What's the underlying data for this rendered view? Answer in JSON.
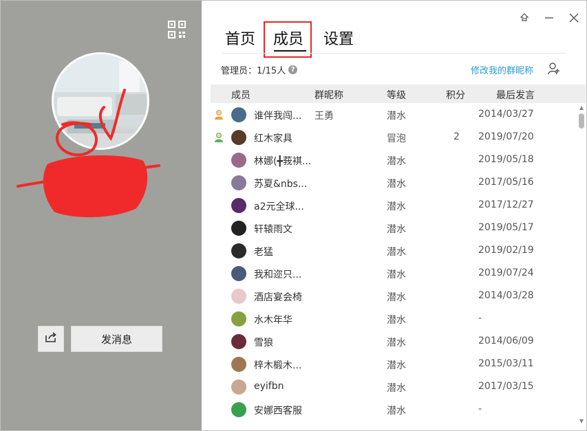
{
  "tabs": [
    {
      "label": "首页"
    },
    {
      "label": "成员"
    },
    {
      "label": "设置"
    }
  ],
  "window_controls": {
    "pin_icon": "pin-icon",
    "minimize_icon": "minimize-icon",
    "close_icon": "close-icon"
  },
  "left": {
    "send_message_label": "发消息",
    "share_icon": "share-icon",
    "qr_icon": "qr-code-icon"
  },
  "admin": {
    "label": "管理员：1/15人",
    "help": "?"
  },
  "edit_nickname_link": "修改我的群昵称",
  "columns": {
    "member": "成员",
    "nickname": "群昵称",
    "level": "等级",
    "points": "积分",
    "last_post": "最后发言"
  },
  "members": [
    {
      "name": "谁伴我闯...",
      "nickname": "王勇",
      "level": "潜水",
      "points": "",
      "last_post": "2014/03/27",
      "role": "owner",
      "avatar_color": "#4a6b8a"
    },
    {
      "name": "红木家具",
      "nickname": "",
      "level": "冒泡",
      "points": "2",
      "last_post": "2019/07/20",
      "role": "admin",
      "avatar_color": "#5a3a2a"
    },
    {
      "name": "林娜(╋莪褀...",
      "nickname": "",
      "level": "潜水",
      "points": "",
      "last_post": "2019/05/18",
      "role": "",
      "avatar_color": "#9a6a8a"
    },
    {
      "name": "苏夏&nbs...",
      "nickname": "",
      "level": "潜水",
      "points": "",
      "last_post": "2017/05/16",
      "role": "",
      "avatar_color": "#8a7a9a"
    },
    {
      "name": "a2元全球...",
      "nickname": "",
      "level": "潜水",
      "points": "",
      "last_post": "2017/12/27",
      "role": "",
      "avatar_color": "#5a2a6a"
    },
    {
      "name": "轩辕雨文",
      "nickname": "",
      "level": "潜水",
      "points": "",
      "last_post": "2019/05/17",
      "role": "",
      "avatar_color": "#222222"
    },
    {
      "name": "老猛",
      "nickname": "",
      "level": "潜水",
      "points": "",
      "last_post": "2019/02/19",
      "role": "",
      "avatar_color": "#2a2a2a"
    },
    {
      "name": "我和迩只...",
      "nickname": "",
      "level": "潜水",
      "points": "",
      "last_post": "2019/07/24",
      "role": "",
      "avatar_color": "#4a5a7a"
    },
    {
      "name": "酒店宴会椅",
      "nickname": "",
      "level": "潜水",
      "points": "",
      "last_post": "2014/03/28",
      "role": "",
      "avatar_color": "#e8c8c8"
    },
    {
      "name": "水木年华",
      "nickname": "",
      "level": "潜水",
      "points": "",
      "last_post": "-",
      "role": "",
      "avatar_color": "#8aa040"
    },
    {
      "name": "雪狼",
      "nickname": "",
      "level": "潜水",
      "points": "",
      "last_post": "2014/06/09",
      "role": "",
      "avatar_color": "#6a2a3a"
    },
    {
      "name": "梓木椴木...",
      "nickname": "",
      "level": "潜水",
      "points": "",
      "last_post": "2015/03/11",
      "role": "",
      "avatar_color": "#a07850"
    },
    {
      "name": "eyifbn",
      "nickname": "",
      "level": "潜水",
      "points": "",
      "last_post": "2017/03/15",
      "role": "",
      "avatar_color": "#c8a890"
    },
    {
      "name": "安娜西客服",
      "nickname": "",
      "level": "潜水",
      "points": "",
      "last_post": "-",
      "role": "",
      "avatar_color": "#3aa050"
    }
  ]
}
